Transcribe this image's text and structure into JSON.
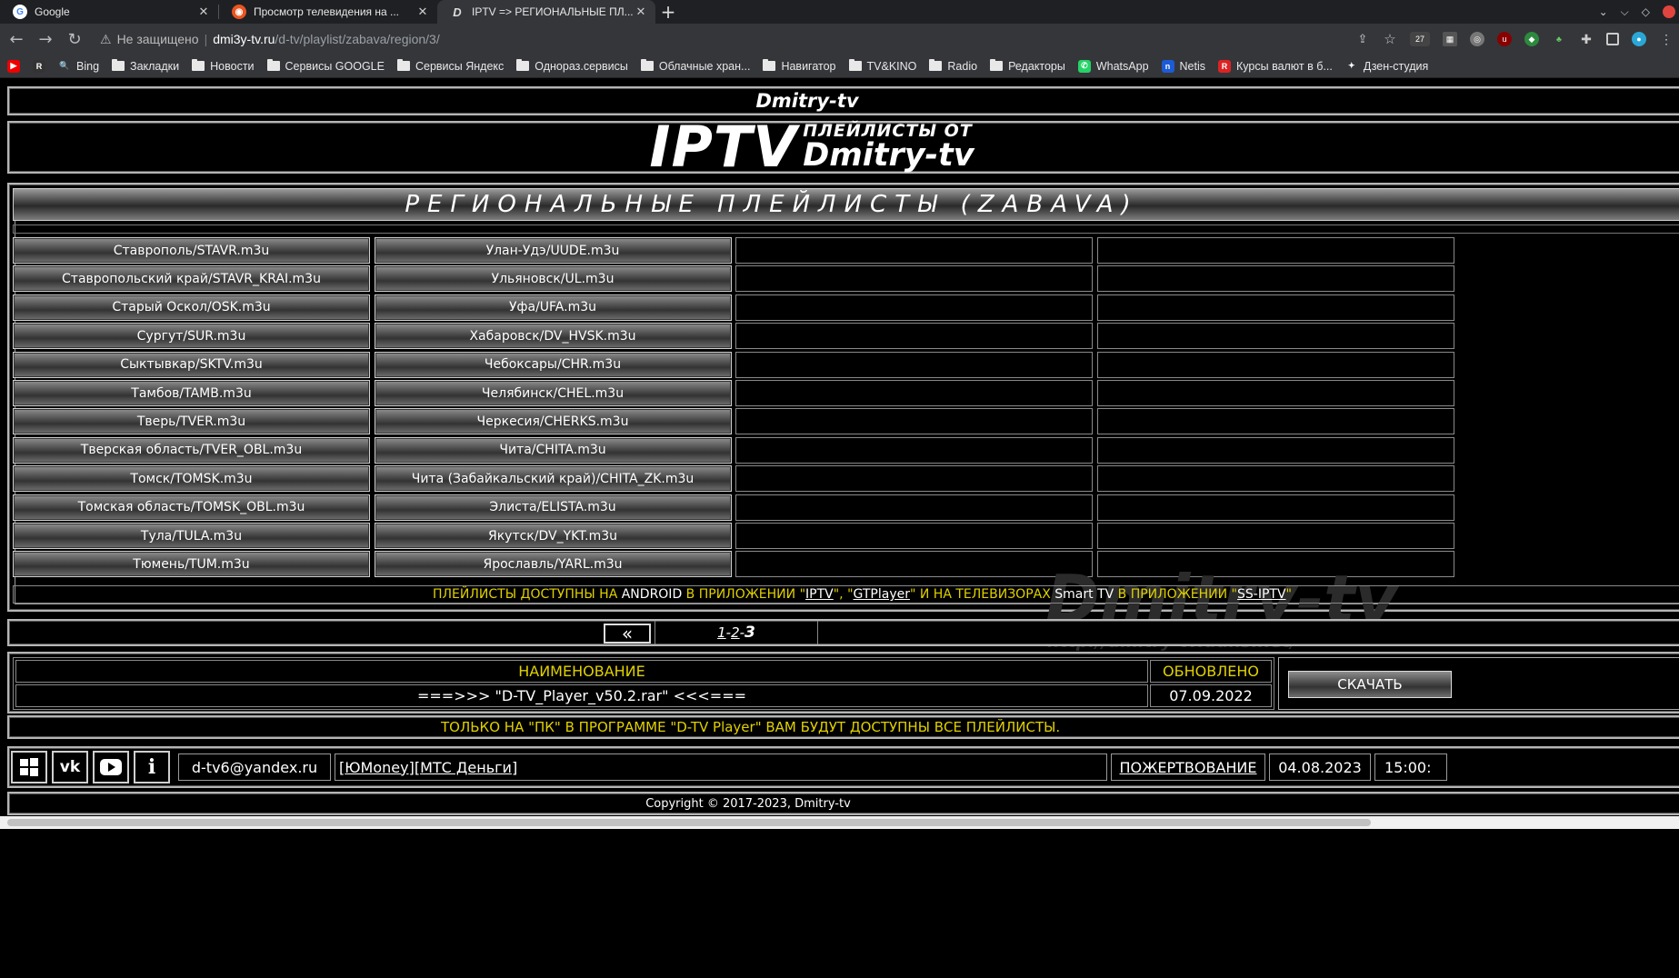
{
  "browser": {
    "tabs": [
      {
        "title": "Google",
        "favicon": "google-icon",
        "active": false
      },
      {
        "title": "Просмотр телевидения на ...",
        "favicon": "ubuntu-icon",
        "active": false
      },
      {
        "title": "IPTV => РЕГИОНАЛЬНЫЕ ПЛ...",
        "favicon": "dmitry-tv-icon",
        "active": true
      }
    ],
    "new_tab": "+",
    "address": {
      "security": "Не защищено",
      "host": "dmi3y-tv.ru",
      "path": "/d-tv/playlist/zabava/region/3/"
    },
    "ext_badge": "27",
    "bookmarks": [
      {
        "label": "",
        "icon": "youtube-icon"
      },
      {
        "label": "",
        "icon": "r-icon"
      },
      {
        "label": "Bing",
        "icon": "bing-search-icon"
      },
      {
        "label": "Закладки",
        "icon": "folder-icon"
      },
      {
        "label": "Новости",
        "icon": "folder-icon"
      },
      {
        "label": "Сервисы GOOGLE",
        "icon": "folder-icon"
      },
      {
        "label": "Сервисы Яндекс",
        "icon": "folder-icon"
      },
      {
        "label": "Однораз.сервисы",
        "icon": "folder-icon"
      },
      {
        "label": "Облачные хран...",
        "icon": "folder-icon"
      },
      {
        "label": "Навигатор",
        "icon": "folder-icon"
      },
      {
        "label": "TV&KINO",
        "icon": "folder-icon"
      },
      {
        "label": "Radio",
        "icon": "folder-icon"
      },
      {
        "label": "Редакторы",
        "icon": "folder-icon"
      },
      {
        "label": "WhatsApp",
        "icon": "whatsapp-icon"
      },
      {
        "label": "Netis",
        "icon": "netis-icon"
      },
      {
        "label": "Курсы валют в б...",
        "icon": "rates-icon"
      },
      {
        "label": "Дзен-студия",
        "icon": "dzen-icon"
      }
    ]
  },
  "site": {
    "name": "Dmitry-tv",
    "logo": {
      "big": "IPTV",
      "small": "ПЛЕЙЛИСТЫ ОТ",
      "name": "Dmitry-tv"
    },
    "section_title": "РЕГИОНАЛЬНЫЕ ПЛЕЙЛИСТЫ (ZABAVA)",
    "playlists_col1": [
      "Ставрополь/STAVR.m3u",
      "Ставропольский край/STAVR_KRAI.m3u",
      "Старый Оскол/OSK.m3u",
      "Сургут/SUR.m3u",
      "Сыктывкар/SKTV.m3u",
      "Тамбов/TAMB.m3u",
      "Тверь/TVER.m3u",
      "Тверская область/TVER_OBL.m3u",
      "Томск/TOMSK.m3u",
      "Томская область/TOMSK_OBL.m3u",
      "Тула/TULA.m3u",
      "Тюмень/TUM.m3u"
    ],
    "playlists_col2": [
      "Улан-Удэ/UUDE.m3u",
      "Ульяновск/UL.m3u",
      "Уфа/UFA.m3u",
      "Хабаровск/DV_HVSK.m3u",
      "Чебоксары/CHR.m3u",
      "Челябинск/CHEL.m3u",
      "Черкесия/CHERKS.m3u",
      "Чита/CHITA.m3u",
      "Чита (Забайкальский край)/CHITA_ZK.m3u",
      "Элиста/ELISTA.m3u",
      "Якутск/DV_YKT.m3u",
      "Ярославль/YARL.m3u"
    ],
    "watermark": {
      "title": "Dmitry-tv",
      "url": "http://dmitry-tv.ddns.net/"
    },
    "availability": {
      "p1": "ПЛЕЙЛИСТЫ ДОСТУПНЫ НА ",
      "p2": "ANDROID",
      "p3": " В ПРИЛОЖЕНИИ \"",
      "link1": "IPTV",
      "p4": "\", \"",
      "link2": "GTPlayer",
      "p5": "\" И НА ТЕЛЕВИЗОРАХ ",
      "p6": "Smart TV",
      "p7": " В ПРИЛОЖЕНИИ \"",
      "link3": "SS-IPTV",
      "p8": "\""
    },
    "pager": {
      "prev": "«",
      "p1": "1",
      "dash": "-",
      "p2": "2",
      "current": "3"
    },
    "download": {
      "name_header": "НАИМЕНОВАНИЕ",
      "updated_header": "ОБНОВЛЕНО",
      "file": "===>>> \"D-TV_Player_v50.2.rar\" <<<===",
      "date": "07.09.2022",
      "button": "СКАЧАТЬ"
    },
    "pc_note": "ТОЛЬКО НА \"ПК\" В ПРОГРАММЕ \"D-TV Player\" ВАМ БУДУТ ДОСТУПНЫ ВСЕ ПЛЕЙЛИСТЫ.",
    "footer": {
      "email": "d-tv6@yandex.ru",
      "pay_open": "[ ",
      "yumoney": "ЮMoney",
      "pay_mid": " ][ ",
      "mts": "МТС Деньги",
      "pay_close": " ]",
      "donate": "ПОЖЕРТВОВАНИЕ",
      "date": "04.08.2023",
      "time": "15:00:"
    },
    "copyright": "Copyright © 2017-2023, Dmitry-tv"
  }
}
